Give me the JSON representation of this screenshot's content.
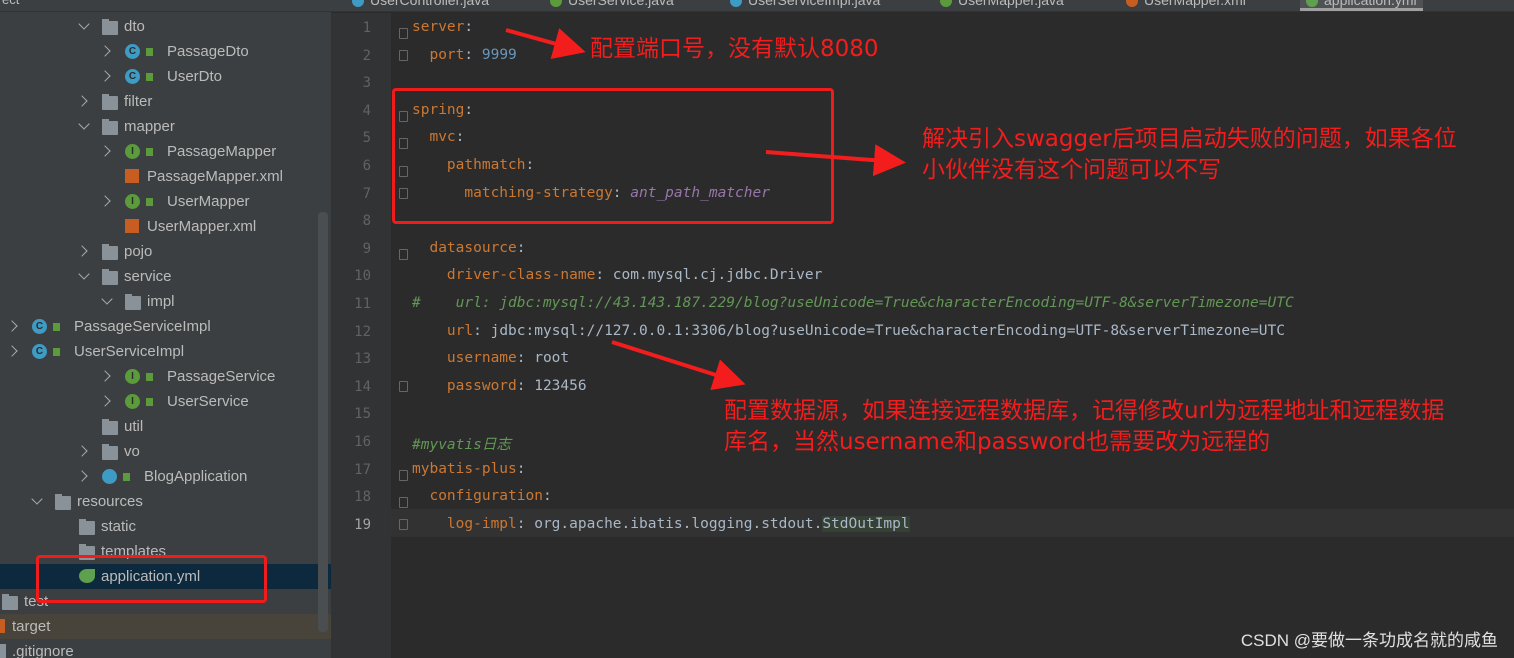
{
  "topbar": {
    "project_fragment": "ect"
  },
  "tabs": [
    {
      "label": "UserController.java",
      "icon": "class-icon",
      "color": "#3d9bc4"
    },
    {
      "label": "UserService.java",
      "icon": "interface-icon",
      "color": "#5c9b3c"
    },
    {
      "label": "UserServiceImpl.java",
      "icon": "class-icon",
      "color": "#3d9bc4"
    },
    {
      "label": "UserMapper.java",
      "icon": "interface-icon",
      "color": "#5c9b3c"
    },
    {
      "label": "UserMapper.xml",
      "icon": "xml-icon",
      "color": "#c75d20"
    },
    {
      "label": "application.yml",
      "icon": "spring-config-icon",
      "color": "#5fa04e",
      "active": true
    }
  ],
  "tree": [
    {
      "label": "dto",
      "type": "folder",
      "level": 2,
      "open": true
    },
    {
      "label": "PassageDto",
      "type": "class",
      "level": 3
    },
    {
      "label": "UserDto",
      "type": "class",
      "level": 3
    },
    {
      "label": "filter",
      "type": "folder",
      "level": 2
    },
    {
      "label": "mapper",
      "type": "folder",
      "level": 2,
      "open": true
    },
    {
      "label": "PassageMapper",
      "type": "interface",
      "level": 3
    },
    {
      "label": "PassageMapper.xml",
      "type": "xml",
      "level": 3
    },
    {
      "label": "UserMapper",
      "type": "interface",
      "level": 3
    },
    {
      "label": "UserMapper.xml",
      "type": "xml",
      "level": 3
    },
    {
      "label": "pojo",
      "type": "folder",
      "level": 2
    },
    {
      "label": "service",
      "type": "folder",
      "level": 2,
      "open": true
    },
    {
      "label": "impl",
      "type": "folder",
      "level": 3,
      "open": true
    },
    {
      "label": "PassageServiceImpl",
      "type": "class",
      "level": 4
    },
    {
      "label": "UserServiceImpl",
      "type": "class",
      "level": 4
    },
    {
      "label": "PassageService",
      "type": "interface",
      "level": 3
    },
    {
      "label": "UserService",
      "type": "interface",
      "level": 3
    },
    {
      "label": "util",
      "type": "folder",
      "level": 2,
      "leaf": true
    },
    {
      "label": "vo",
      "type": "folder",
      "level": 2
    },
    {
      "label": "BlogApplication",
      "type": "app",
      "level": 2
    },
    {
      "label": "resources",
      "type": "folder",
      "level": 0,
      "open": true
    },
    {
      "label": "static",
      "type": "folder",
      "level": 1,
      "leaf": true
    },
    {
      "label": "templates",
      "type": "folder",
      "level": 1,
      "leaf": true
    },
    {
      "label": "application.yml",
      "type": "spring",
      "level": 1,
      "selected": true
    },
    {
      "label": "test",
      "type": "folder",
      "level": -1,
      "leaf": true
    },
    {
      "label": "target",
      "type": "target",
      "level": -1
    },
    {
      "label": ".gitignore",
      "type": "file",
      "level": -1
    }
  ],
  "editor": {
    "current_line": 19,
    "lines": [
      [
        {
          "t": "server",
          "c": "k"
        },
        {
          "t": ":"
        }
      ],
      [
        {
          "t": "  "
        },
        {
          "t": "port",
          "c": "k"
        },
        {
          "t": ": "
        },
        {
          "t": "9999",
          "c": "n"
        }
      ],
      [],
      [
        {
          "t": "spring",
          "c": "k"
        },
        {
          "t": ":"
        }
      ],
      [
        {
          "t": "  "
        },
        {
          "t": "mvc",
          "c": "k"
        },
        {
          "t": ":"
        }
      ],
      [
        {
          "t": "    "
        },
        {
          "t": "pathmatch",
          "c": "k"
        },
        {
          "t": ":"
        }
      ],
      [
        {
          "t": "      "
        },
        {
          "t": "matching-strategy",
          "c": "k"
        },
        {
          "t": ": "
        },
        {
          "t": "ant_path_matcher",
          "c": "p"
        }
      ],
      [],
      [
        {
          "t": "  "
        },
        {
          "t": "datasource",
          "c": "k"
        },
        {
          "t": ":"
        }
      ],
      [
        {
          "t": "    "
        },
        {
          "t": "driver-class-name",
          "c": "k"
        },
        {
          "t": ": com.mysql.cj.jdbc.Driver"
        }
      ],
      [
        {
          "t": "#    url: jdbc:mysql://43.143.187.229/blog?useUnicode=True&characterEncoding=UTF-8&serverTimezone=UTC",
          "c": "cm"
        }
      ],
      [
        {
          "t": "    "
        },
        {
          "t": "url",
          "c": "k"
        },
        {
          "t": ": jdbc:mysql://127.0.0.1:3306/blog?useUnicode=True&characterEncoding=UTF-8&serverTimezone=UTC"
        }
      ],
      [
        {
          "t": "    "
        },
        {
          "t": "username",
          "c": "k"
        },
        {
          "t": ": root"
        }
      ],
      [
        {
          "t": "    "
        },
        {
          "t": "password",
          "c": "k"
        },
        {
          "t": ": 123456"
        }
      ],
      [],
      [
        {
          "t": "#myvatis日志",
          "c": "cm"
        }
      ],
      [
        {
          "t": "mybatis-plus",
          "c": "k"
        },
        {
          "t": ":"
        }
      ],
      [
        {
          "t": "  "
        },
        {
          "t": "configuration",
          "c": "k"
        },
        {
          "t": ":"
        }
      ],
      [
        {
          "t": "    "
        },
        {
          "t": "log-impl",
          "c": "k"
        },
        {
          "t": ": org.apache.ibatis.logging.stdout."
        },
        {
          "t": "StdOutImpl",
          "c": "hl"
        }
      ]
    ]
  },
  "annotations": {
    "port": "配置端口号，没有默认8080",
    "swagger": [
      "解决引入swagger后项目启动失败的问题，如果各位",
      "小伙伴没有这个问题可以不写"
    ],
    "datasource": [
      "配置数据源，如果连接远程数据库，记得修改url为远程地址和远程数据",
      "库名，当然username和password也需要改为远程的"
    ],
    "color": "#f41d1d"
  },
  "watermark": "CSDN @要做一条功成名就的咸鱼"
}
